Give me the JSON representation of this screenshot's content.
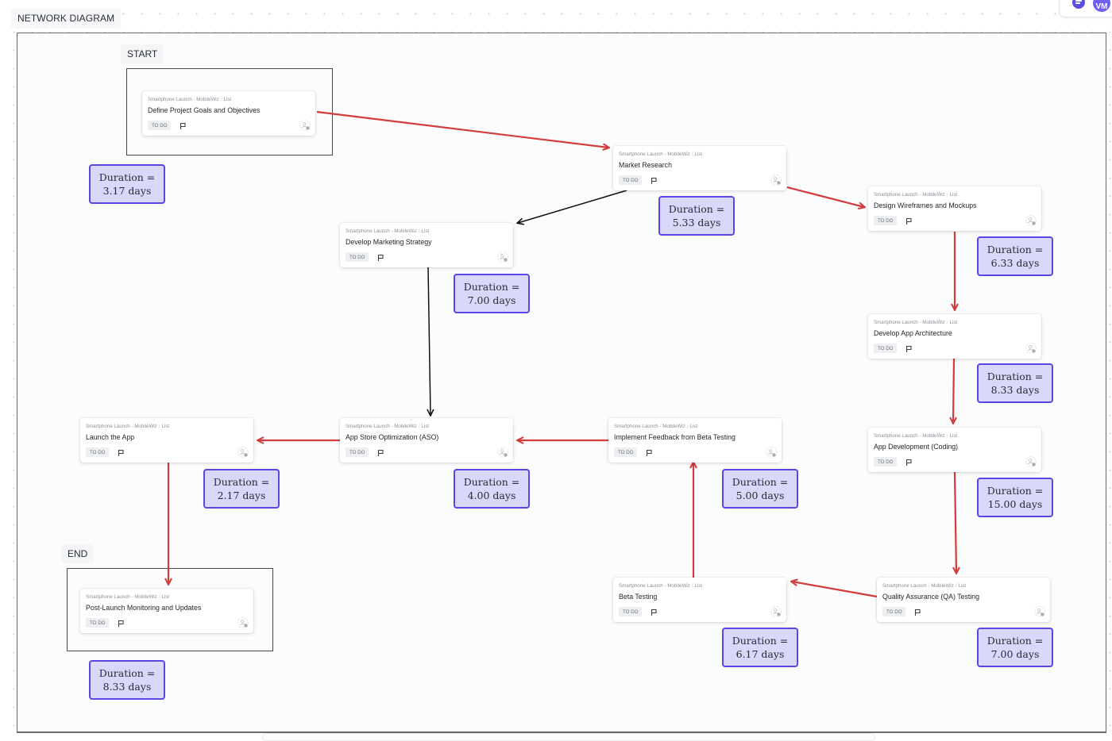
{
  "header": {
    "title": "NETWORK DIAGRAM",
    "avatar_initials": "VM",
    "menu_icon": "list-icon"
  },
  "labels": {
    "start": "START",
    "end": "END"
  },
  "card_common": {
    "project": "Smartphone Launch - MobileWiz",
    "separator": "/",
    "list": "List",
    "status": "TO DO",
    "flag_icon": "flag-icon",
    "assignee_icon": "add-assignee-icon"
  },
  "tasks": [
    {
      "id": "define-goals",
      "name": "Define Project Goals and Objectives",
      "duration_label": "Duration =",
      "duration": "3.17 days"
    },
    {
      "id": "market-research",
      "name": "Market Research",
      "duration_label": "Duration =",
      "duration": "5.33 days"
    },
    {
      "id": "design-wireframes",
      "name": "Design Wireframes and Mockups",
      "duration_label": "Duration =",
      "duration": "6.33 days"
    },
    {
      "id": "marketing-strategy",
      "name": "Develop Marketing Strategy",
      "duration_label": "Duration =",
      "duration": "7.00 days"
    },
    {
      "id": "app-architecture",
      "name": "Develop App Architecture",
      "duration_label": "Duration =",
      "duration": "8.33 days"
    },
    {
      "id": "app-development",
      "name": "App Development (Coding)",
      "duration_label": "Duration =",
      "duration": "15.00 days"
    },
    {
      "id": "launch-app",
      "name": "Launch the App",
      "duration_label": "Duration =",
      "duration": "2.17 days"
    },
    {
      "id": "aso",
      "name": "App Store Optimization (ASO)",
      "duration_label": "Duration =",
      "duration": "4.00 days"
    },
    {
      "id": "implement-feedback",
      "name": "Implement Feedback from Beta Testing",
      "duration_label": "Duration =",
      "duration": "5.00 days"
    },
    {
      "id": "beta-testing",
      "name": "Beta Testing",
      "duration_label": "Duration =",
      "duration": "6.17 days"
    },
    {
      "id": "qa-testing",
      "name": "Quality Assurance (QA) Testing",
      "duration_label": "Duration =",
      "duration": "7.00 days"
    },
    {
      "id": "post-launch",
      "name": "Post-Launch Monitoring and Updates",
      "duration_label": "Duration =",
      "duration": "8.33 days"
    }
  ],
  "dependencies": [
    {
      "from": "define-goals",
      "to": "market-research",
      "critical": true
    },
    {
      "from": "market-research",
      "to": "design-wireframes",
      "critical": true
    },
    {
      "from": "market-research",
      "to": "marketing-strategy",
      "critical": false
    },
    {
      "from": "design-wireframes",
      "to": "app-architecture",
      "critical": true
    },
    {
      "from": "app-architecture",
      "to": "app-development",
      "critical": true
    },
    {
      "from": "app-development",
      "to": "qa-testing",
      "critical": true
    },
    {
      "from": "qa-testing",
      "to": "beta-testing",
      "critical": true
    },
    {
      "from": "beta-testing",
      "to": "implement-feedback",
      "critical": true
    },
    {
      "from": "implement-feedback",
      "to": "aso",
      "critical": true
    },
    {
      "from": "marketing-strategy",
      "to": "aso",
      "critical": false
    },
    {
      "from": "aso",
      "to": "launch-app",
      "critical": true
    },
    {
      "from": "launch-app",
      "to": "post-launch",
      "critical": true
    }
  ],
  "colors": {
    "critical_path": "#d23c3c",
    "non_critical_path": "#111111",
    "duration_fill": "#d9d8fb",
    "duration_border": "#5a45e6",
    "accent": "#5b4fe0"
  }
}
